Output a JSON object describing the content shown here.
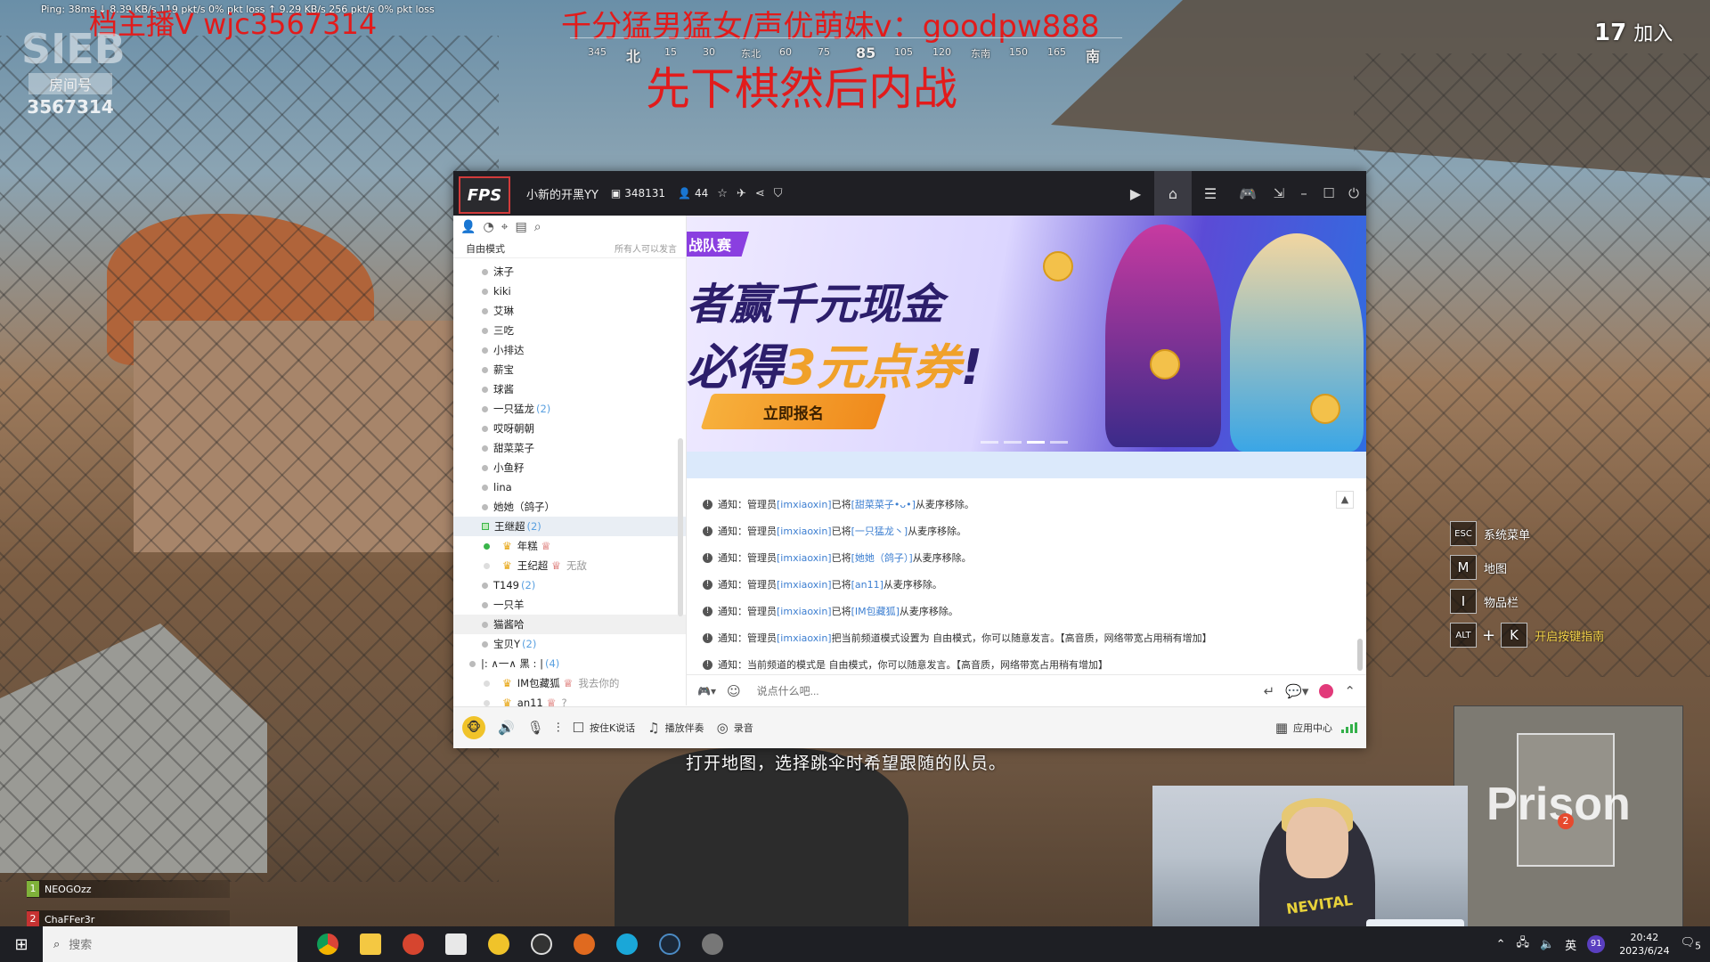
{
  "hud": {
    "net_stats": "Ping: 38ms     ↓ 8.39 KB/s  119 pkt/s  0% pkt loss    ↑ 9.29 KB/s  256 pkt/s  0% pkt loss",
    "overlay_1": "档主播V  wjc3567314",
    "overlay_2": "千分猛男猛女/声优萌妹v：goodpw888",
    "overlay_3": "先下棋然后内战",
    "room_logo": "SIEB",
    "room_label": "房间号",
    "room_number": "3567314",
    "compass": [
      {
        "text": "345"
      },
      {
        "text": "北",
        "main": true
      },
      {
        "text": "15"
      },
      {
        "text": "30"
      },
      {
        "text": "东北"
      },
      {
        "text": "60"
      },
      {
        "text": "75"
      },
      {
        "text": "85",
        "main": true
      },
      {
        "text": "105"
      },
      {
        "text": "120"
      },
      {
        "text": "东南"
      },
      {
        "text": "150"
      },
      {
        "text": "165"
      },
      {
        "text": "南",
        "main": true
      }
    ],
    "player_count": "17",
    "join_label": "加入",
    "key_hints": [
      {
        "key": "ESC",
        "label": "系统菜单"
      },
      {
        "key": "M",
        "label": "地图"
      },
      {
        "key": "I",
        "label": "物品栏"
      },
      {
        "key": "ALT",
        "key2": "K",
        "label": "开启按键指南"
      }
    ],
    "subtitle": "打开地图，选择跳伞时希望跟随的队员。",
    "minimap_label": "Prison",
    "minimap_marker": "2",
    "team": [
      {
        "num": "1",
        "name": "NEOGOzz"
      },
      {
        "num": "2",
        "name": "ChaFFer3r"
      }
    ],
    "webcam_shirt": "NEVITAL"
  },
  "yy": {
    "logo": "FPS",
    "channel_name": "小新的开黑YY",
    "channel_id": "348131",
    "online_count": "44",
    "mode": "自由模式",
    "mode_note": "所有人可以发言",
    "users": [
      {
        "name": "沫子"
      },
      {
        "name": "kiki"
      },
      {
        "name": "艾琳"
      },
      {
        "name": "三吃"
      },
      {
        "name": "小排达"
      },
      {
        "name": "薪宝"
      },
      {
        "name": "球酱"
      },
      {
        "name": "一只猛龙",
        "count": "(2)"
      },
      {
        "name": "哎呀朝朝"
      },
      {
        "name": "甜菜菜子"
      },
      {
        "name": "小鱼籽"
      },
      {
        "name": "lina"
      },
      {
        "name": "她她（鸽子）"
      },
      {
        "name": "王继超",
        "count": "(2)",
        "selected": true
      },
      {
        "name": "年糕",
        "sub": true,
        "online": true
      },
      {
        "name": "王纪超",
        "sub": true,
        "note": "无敌"
      },
      {
        "name": "T149",
        "count": "(2)"
      },
      {
        "name": "一只羊"
      },
      {
        "name": "猫酱哈",
        "hover": true
      },
      {
        "name": "宝贝Y",
        "count": "(2)"
      },
      {
        "name": "|:      ∧一∧      黑        :  |",
        "count": "(4)",
        "top": true
      },
      {
        "name": "IM包藏狐",
        "sub": true,
        "note": "我去你的"
      },
      {
        "name": "an11",
        "sub": true,
        "note": "?"
      }
    ],
    "banner": {
      "tag": "战队赛",
      "line1": "者赢千元现金",
      "line2_a": "必得",
      "line2_b": "3元点券",
      "line2_c": "!",
      "button": "立即报名"
    },
    "messages": [
      {
        "a": "通知：管理员 ",
        "b": "[imxiaoxin]",
        "c": " 已将 ",
        "d": "[甜菜菜子•ᴗ•]",
        "e": " 从麦序移除。"
      },
      {
        "a": "通知：管理员 ",
        "b": "[imxiaoxin]",
        "c": " 已将 ",
        "d": "[一只猛龙丶]",
        "e": " 从麦序移除。"
      },
      {
        "a": "通知：管理员 ",
        "b": "[imxiaoxin]",
        "c": " 已将 ",
        "d": "[她她（鸽子）]",
        "e": " 从麦序移除。"
      },
      {
        "a": "通知：管理员 ",
        "b": "[imxiaoxin]",
        "c": " 已将 ",
        "d": "[an11]",
        "e": " 从麦序移除。"
      },
      {
        "a": "通知：管理员 ",
        "b": "[imxiaoxin]",
        "c": " 已将 ",
        "d": "[IM包藏狐]",
        "e": " 从麦序移除。"
      },
      {
        "a": "通知：管理员 ",
        "b": "[imxiaoxin]",
        "c": " 把当前频道模式设置为 自由模式，你可以随意发言。【高音质，网络带宽占用稍有增加】",
        "d": "",
        "e": ""
      },
      {
        "a": "通知：当前频道的模式是 自由模式，你可以随意发言。【高音质，网络带宽占用稍有增加】",
        "b": "",
        "c": "",
        "d": "",
        "e": ""
      }
    ],
    "input_placeholder": "说点什么吧...",
    "bottom": {
      "push_to_talk": "按住K说话",
      "music": "播放伴奏",
      "record": "录音",
      "app_center": "应用中心"
    }
  },
  "taskbar": {
    "search": "搜索",
    "ime": "英",
    "notif_count": "91",
    "time": "20:42",
    "date": "2023/6/24",
    "msg_count": "5"
  }
}
